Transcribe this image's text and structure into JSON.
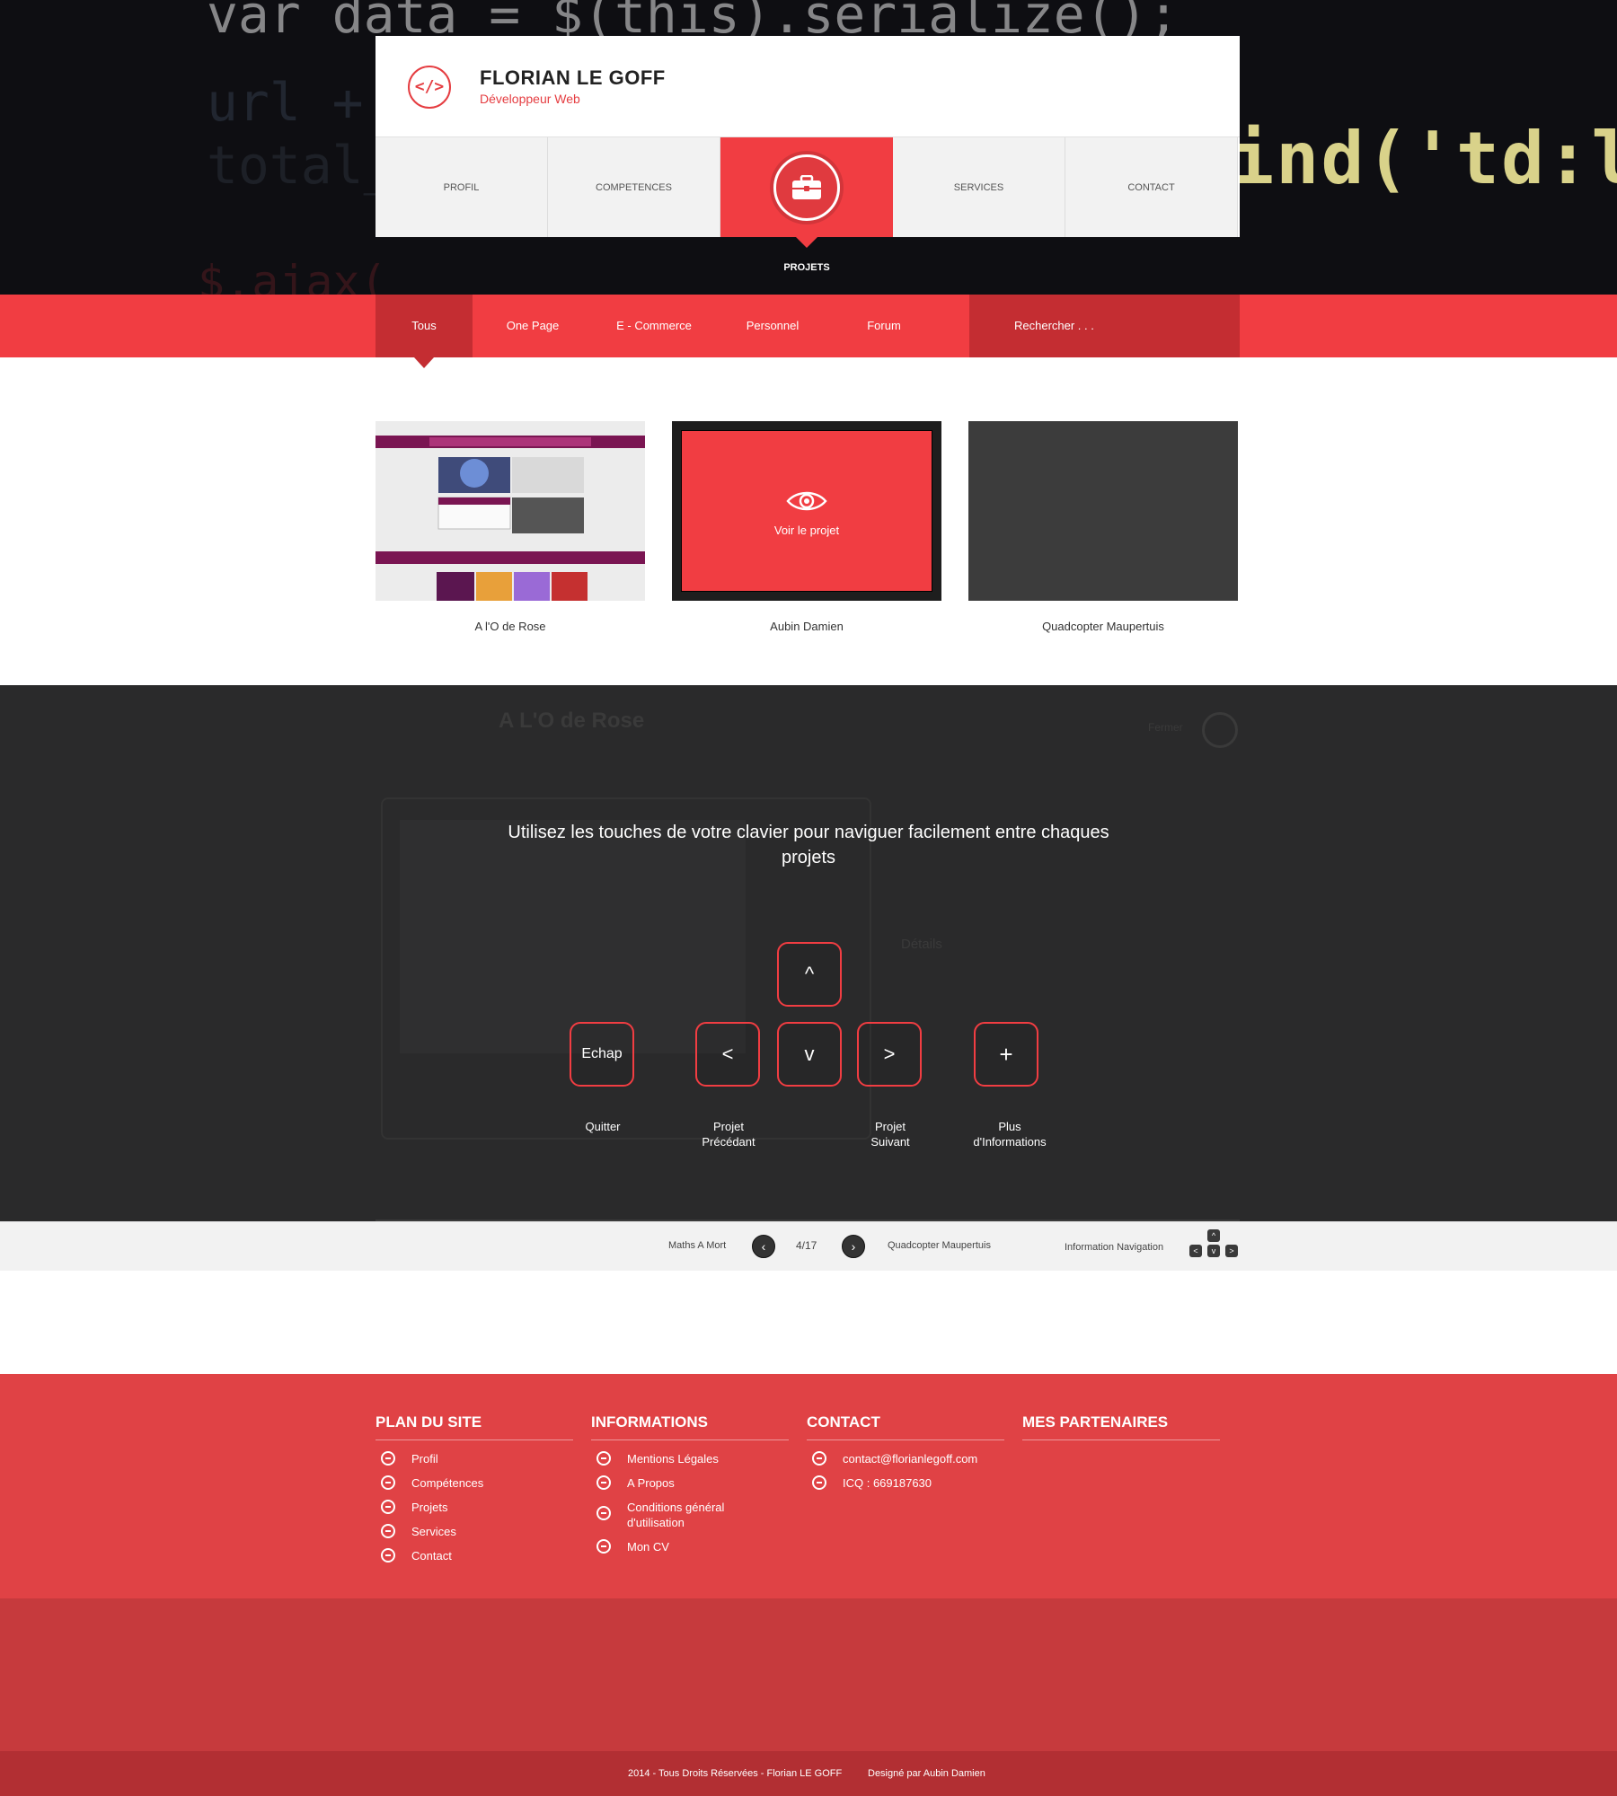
{
  "header": {
    "brand_name": "FLORIAN LE GOFF",
    "brand_subtitle": "Développeur Web",
    "logo_glyph": "</>",
    "nav": [
      {
        "label": "PROFIL"
      },
      {
        "label": "COMPETENCES"
      },
      {
        "label": "PROJETS",
        "active": true
      },
      {
        "label": "SERVICES"
      },
      {
        "label": "CONTACT"
      }
    ],
    "active_label": "PROJETS"
  },
  "hero_code": {
    "line1": "var data = $(this).serialize();",
    "line5": "ind('td:last"
  },
  "filters": {
    "items": [
      "Tous",
      "One Page",
      "E - Commerce",
      "Personnel",
      "Forum"
    ],
    "active": "Tous",
    "search_placeholder": "Rechercher . . ."
  },
  "projects": [
    {
      "title": "A l'O de Rose"
    },
    {
      "title": "Aubin Damien",
      "hover_label": "Voir le projet"
    },
    {
      "title": "Quadcopter Maupertuis"
    }
  ],
  "overlay": {
    "message": "Utilisez les touches de votre clavier pour naviguer facilement entre chaques projets",
    "keys": {
      "esc": "Echap",
      "up": "^",
      "left": "<",
      "down": "v",
      "right": ">",
      "plus": "+"
    },
    "labels": {
      "quit": "Quitter",
      "prev": "Projet Précédant",
      "next": "Projet Suivant",
      "more": "Plus d'Informations"
    }
  },
  "pager": {
    "prev_project": "Maths A Mort",
    "position": "4/17",
    "next_project": "Quadcopter Maupertuis",
    "nav_info": "Information Navigation"
  },
  "footer": {
    "columns": [
      {
        "title": "PLAN DU SITE",
        "links": [
          "Profil",
          "Compétences",
          "Projets",
          "Services",
          "Contact"
        ]
      },
      {
        "title": "INFORMATIONS",
        "links": [
          "Mentions Légales",
          "A Propos",
          "Conditions général d'utilisation",
          "Mon CV"
        ]
      },
      {
        "title": "CONTACT",
        "links": [
          "contact@florianlegoff.com",
          "ICQ : 669187630"
        ]
      },
      {
        "title": "MES PARTENAIRES",
        "links": []
      }
    ],
    "copyright": "2014 - Tous Droits Réservées  - Florian LE GOFF",
    "designer": "Designé par Aubin Damien"
  },
  "colors": {
    "accent": "#f13d42",
    "accent_dark": "#c42d32",
    "overlay_bg": "#2a2a2b",
    "footer_bg": "#e04245"
  }
}
